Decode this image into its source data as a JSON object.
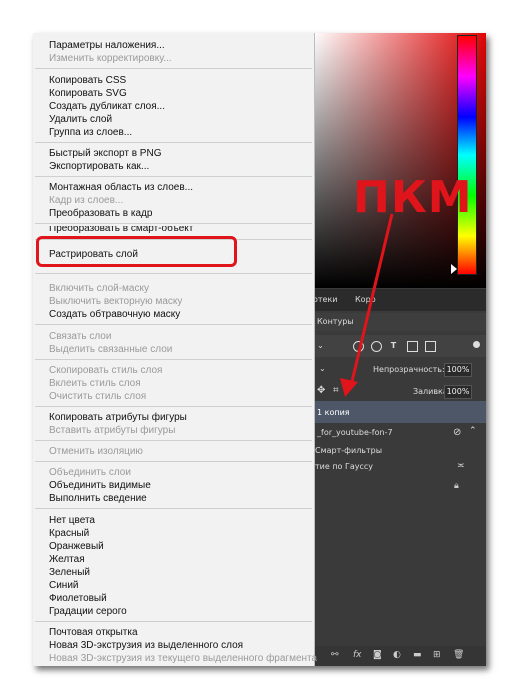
{
  "context_menu": {
    "groups": [
      [
        {
          "label": "Параметры наложения...",
          "enabled": true
        },
        {
          "label": "Изменить корректировку...",
          "enabled": false
        }
      ],
      [
        {
          "label": "Копировать CSS",
          "enabled": true
        },
        {
          "label": "Копировать SVG",
          "enabled": true
        },
        {
          "label": "Создать дубликат слоя...",
          "enabled": true
        },
        {
          "label": "Удалить слой",
          "enabled": true
        },
        {
          "label": "Группа из слоев...",
          "enabled": true
        }
      ],
      [
        {
          "label": "Быстрый экспорт в PNG",
          "enabled": true
        },
        {
          "label": "Экспортировать как...",
          "enabled": true
        }
      ],
      [
        {
          "label": "Монтажная область из слоев...",
          "enabled": true
        },
        {
          "label": "Кадр из слоев...",
          "enabled": false
        },
        {
          "label": "Преобразовать в кадр",
          "enabled": true
        }
      ],
      [
        {
          "label": "Преобразовать в смарт-объект",
          "enabled": true
        }
      ],
      [
        {
          "label": "Растрировать слой",
          "enabled": true
        }
      ],
      [
        {
          "label": "Включить слой-маску",
          "enabled": false
        },
        {
          "label": "Выключить векторную маску",
          "enabled": false
        },
        {
          "label": "Создать обтравочную маску",
          "enabled": true
        }
      ],
      [
        {
          "label": "Связать слои",
          "enabled": false
        },
        {
          "label": "Выделить связанные слои",
          "enabled": false
        }
      ],
      [
        {
          "label": "Скопировать стиль слоя",
          "enabled": false
        },
        {
          "label": "Вклеить стиль слоя",
          "enabled": false
        },
        {
          "label": "Очистить стиль слоя",
          "enabled": false
        }
      ],
      [
        {
          "label": "Копировать атрибуты фигуры",
          "enabled": true
        },
        {
          "label": "Вставить атрибуты фигуры",
          "enabled": false
        }
      ],
      [
        {
          "label": "Отменить изоляцию",
          "enabled": false
        }
      ],
      [
        {
          "label": "Объединить слои",
          "enabled": false
        },
        {
          "label": "Объединить видимые",
          "enabled": true
        },
        {
          "label": "Выполнить сведение",
          "enabled": true
        }
      ],
      [
        {
          "label": "Нет цвета",
          "enabled": true
        },
        {
          "label": "Красный",
          "enabled": true
        },
        {
          "label": "Оранжевый",
          "enabled": true
        },
        {
          "label": "Желтая",
          "enabled": true
        },
        {
          "label": "Зеленый",
          "enabled": true
        },
        {
          "label": "Синий",
          "enabled": true
        },
        {
          "label": "Фиолетовый",
          "enabled": true
        },
        {
          "label": "Градации серого",
          "enabled": true
        }
      ],
      [
        {
          "label": "Почтовая открытка",
          "enabled": true
        },
        {
          "label": "Новая 3D-экструзия из выделенного слоя",
          "enabled": true
        },
        {
          "label": "Новая 3D-экструзия из текущего выделенного фрагмента",
          "enabled": false
        }
      ]
    ]
  },
  "annotation": {
    "label": "ПКМ",
    "color": "#e0141b",
    "highlighted_item": "Растрировать слой"
  },
  "layers_panel": {
    "tab_layers": "отеки",
    "tab_corrections": "Корр",
    "tab_contours": "Контуры",
    "opacity_label": "Непрозрачность:",
    "opacity_value": "100%",
    "fill_label": "Заливка:",
    "fill_value": "100%",
    "layers": [
      {
        "name": "1 копия",
        "selected": true
      },
      {
        "name": "_for_youtube-fon-7",
        "selected": false
      },
      {
        "name": "Смарт-фильтры",
        "selected": false
      },
      {
        "name": "тие по Гауссу",
        "selected": false
      }
    ],
    "bottom_icons": [
      "link-icon",
      "fx-icon",
      "mask-icon",
      "adjustment-icon",
      "folder-icon",
      "new-layer-icon",
      "trash-icon"
    ]
  }
}
